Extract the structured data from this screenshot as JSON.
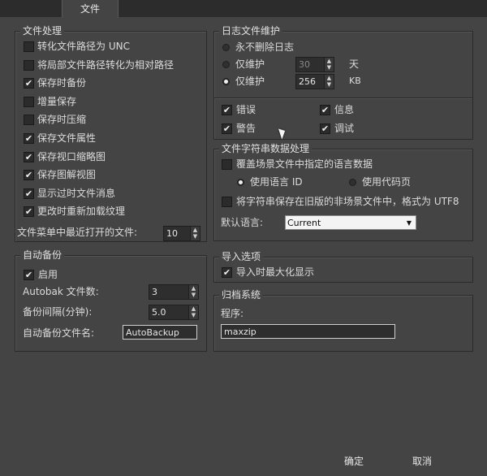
{
  "tab": {
    "label": "文件"
  },
  "file_handling": {
    "title": "文件处理",
    "options": [
      {
        "label": "转化文件路径为 UNC",
        "checked": false
      },
      {
        "label": "将局部文件路径转化为相对路径",
        "checked": false
      },
      {
        "label": "保存时备份",
        "checked": true
      },
      {
        "label": "增量保存",
        "checked": false
      },
      {
        "label": "保存时压缩",
        "checked": false
      },
      {
        "label": "保存文件属性",
        "checked": true
      },
      {
        "label": "保存视口缩略图",
        "checked": true
      },
      {
        "label": "保存图解视图",
        "checked": true
      },
      {
        "label": "显示过时文件消息",
        "checked": true
      },
      {
        "label": "更改时重新加载纹理",
        "checked": true
      }
    ],
    "recent_label": "文件菜单中最近打开的文件:",
    "recent_value": "10"
  },
  "log": {
    "title": "日志文件维护",
    "never_delete": "永不删除日志",
    "keep_days_label": "仅维护",
    "keep_days_value": "30",
    "keep_days_unit": "天",
    "keep_size_label": "仅维护",
    "keep_size_value": "256",
    "keep_size_unit": "KB",
    "selected": "size"
  },
  "msg_types": {
    "error": {
      "label": "错误",
      "checked": true
    },
    "info": {
      "label": "信息",
      "checked": true
    },
    "warning": {
      "label": "警告",
      "checked": true
    },
    "debug": {
      "label": "调试",
      "checked": true
    }
  },
  "string_data": {
    "title": "文件字符串数据处理",
    "override_label": "覆盖场景文件中指定的语言数据",
    "override_checked": false,
    "use_lang_id": "使用语言 ID",
    "use_codepage": "使用代码页",
    "lang_selected": "lang_id",
    "save_legacy_label": "将字符串保存在旧版的非场景文件中，格式为 UTF8",
    "save_legacy_checked": false,
    "default_lang_label": "默认语言:",
    "default_lang_value": "Current"
  },
  "autobackup": {
    "title": "自动备份",
    "enable_label": "启用",
    "enable_checked": true,
    "count_label": "Autobak 文件数:",
    "count_value": "3",
    "interval_label": "备份间隔(分钟):",
    "interval_value": "5.0",
    "name_label": "自动备份文件名:",
    "name_value": "AutoBackup"
  },
  "import": {
    "title": "导入选项",
    "maximize_label": "导入时最大化显示",
    "maximize_checked": true
  },
  "archive": {
    "title": "归档系统",
    "program_label": "程序:",
    "program_value": "maxzip"
  },
  "footer": {
    "ok": "确定",
    "cancel": "取消"
  }
}
